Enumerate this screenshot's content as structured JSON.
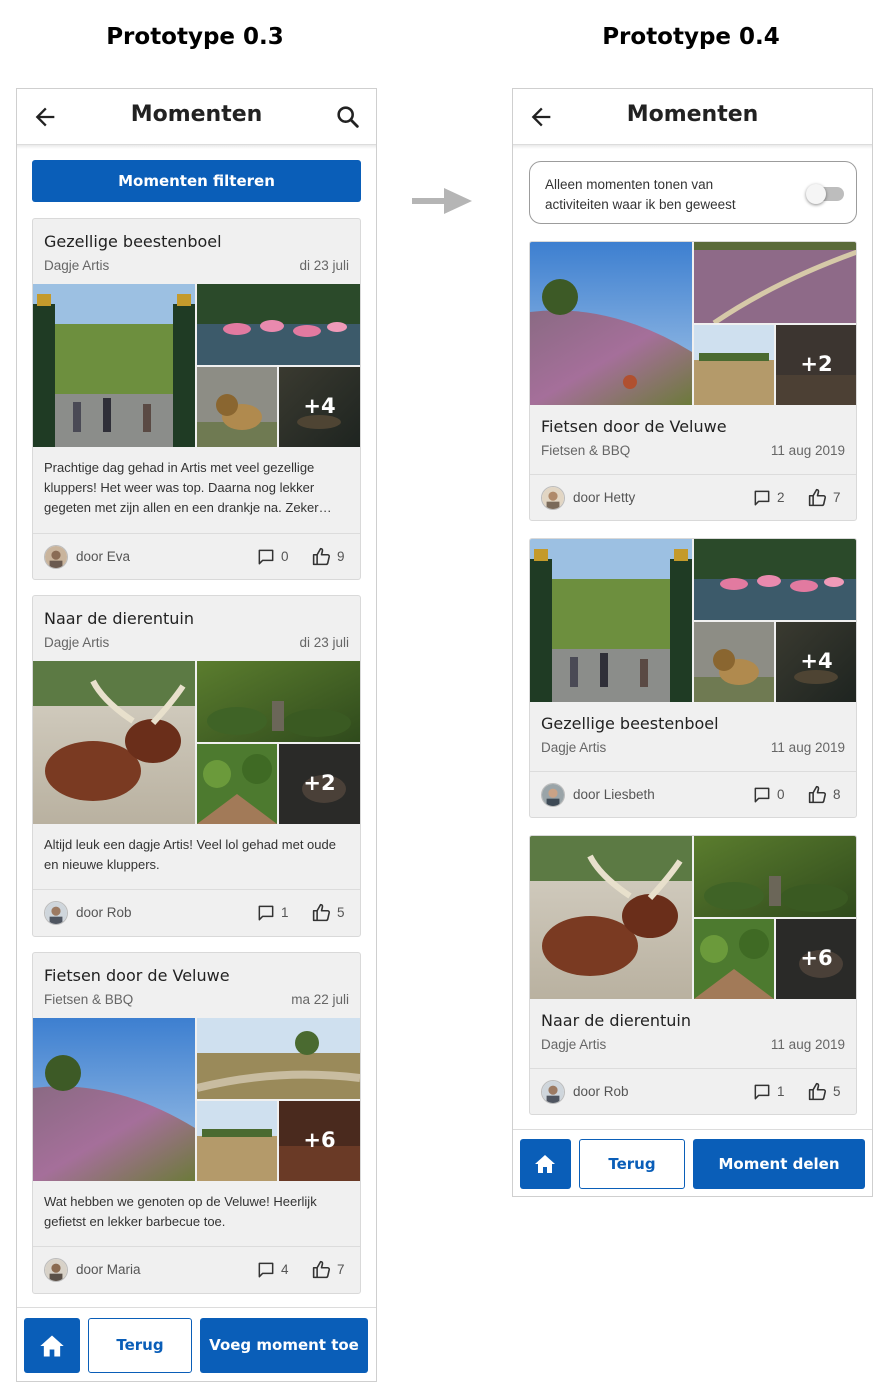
{
  "colors": {
    "primary": "#0a5eb8",
    "card_bg": "#f0f0f0",
    "arrow": "#b5b5b5"
  },
  "left": {
    "heading": "Prototype 0.3",
    "app_title": "Momenten",
    "filter_button": "Momenten filteren",
    "posts": [
      {
        "title": "Gezellige beestenboel",
        "subtitle": "Dagje Artis",
        "date": "di 23 juli",
        "more_photos": "+4",
        "description": "Prachtige dag gehad in Artis met veel gezellige kluppers! Het weer was top. Daarna nog lekker gegeten met zijn allen en een drankje na. Zeker…",
        "author": "door Eva",
        "comments": "0",
        "likes": "9"
      },
      {
        "title": "Naar de dierentuin",
        "subtitle": "Dagje Artis",
        "date": "di 23 juli",
        "more_photos": "+2",
        "description": "Altijd leuk een dagje Artis! Veel lol gehad met oude en nieuwe kluppers.",
        "author": "door Rob",
        "comments": "1",
        "likes": "5"
      },
      {
        "title": "Fietsen door de Veluwe",
        "subtitle": "Fietsen & BBQ",
        "date": "ma 22 juli",
        "more_photos": "+6",
        "description": "Wat hebben we genoten op de Veluwe! Heerlijk gefietst en lekker barbecue toe.",
        "author": "door Maria",
        "comments": "4",
        "likes": "7"
      }
    ],
    "bottom": {
      "back_label": "Terug",
      "action_label": "Voeg moment toe"
    }
  },
  "right": {
    "heading": "Prototype 0.4",
    "app_title": "Momenten",
    "toggle_label": "Alleen momenten tonen van activiteiten waar ik ben geweest",
    "toggle_on": false,
    "posts": [
      {
        "title": "Fietsen door de Veluwe",
        "subtitle": "Fietsen & BBQ",
        "date": "11 aug 2019",
        "more_photos": "+2",
        "author": "door Hetty",
        "comments": "2",
        "likes": "7"
      },
      {
        "title": "Gezellige beestenboel",
        "subtitle": "Dagje Artis",
        "date": "11 aug 2019",
        "more_photos": "+4",
        "author": "door Liesbeth",
        "comments": "0",
        "likes": "8"
      },
      {
        "title": "Naar de dierentuin",
        "subtitle": "Dagje Artis",
        "date": "11 aug 2019",
        "more_photos": "+6",
        "author": "door Rob",
        "comments": "1",
        "likes": "5"
      }
    ],
    "bottom": {
      "back_label": "Terug",
      "action_label": "Moment delen"
    }
  }
}
